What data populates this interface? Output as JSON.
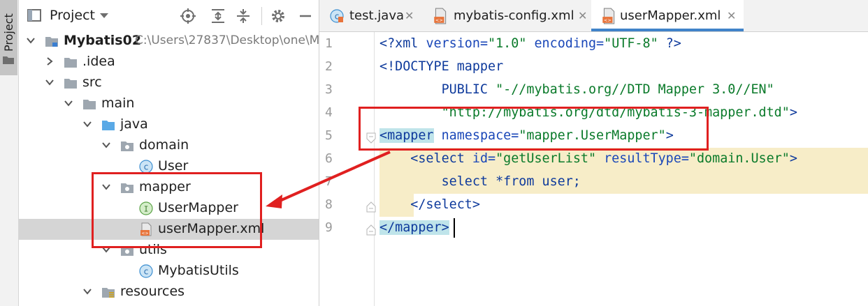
{
  "tool_strip": {
    "project_tab_label": "Project"
  },
  "project_panel": {
    "title": "Project",
    "tree": [
      {
        "label": "Mybatis02",
        "path": "C:\\Users\\27837\\Desktop\\one\\M",
        "icon": "module-folder-icon",
        "expanded": true
      },
      {
        "label": ".idea",
        "icon": "folder-icon",
        "expanded": false
      },
      {
        "label": "src",
        "icon": "folder-icon",
        "expanded": true
      },
      {
        "label": "main",
        "icon": "folder-icon",
        "expanded": true
      },
      {
        "label": "java",
        "icon": "source-folder-icon",
        "expanded": true
      },
      {
        "label": "domain",
        "icon": "package-icon",
        "expanded": true
      },
      {
        "label": "User",
        "icon": "class-icon"
      },
      {
        "label": "mapper",
        "icon": "package-icon",
        "expanded": true
      },
      {
        "label": "UserMapper",
        "icon": "interface-icon"
      },
      {
        "label": "userMapper.xml",
        "icon": "xml-file-icon",
        "selected": true
      },
      {
        "label": "utils",
        "icon": "package-icon",
        "expanded": true
      },
      {
        "label": "MybatisUtils",
        "icon": "class-icon"
      },
      {
        "label": "resources",
        "icon": "resources-folder-icon",
        "expanded": true
      }
    ]
  },
  "editor": {
    "tabs": [
      {
        "label": "test.java",
        "icon": "java-class-icon",
        "active": false
      },
      {
        "label": "mybatis-config.xml",
        "icon": "xml-file-icon",
        "active": false
      },
      {
        "label": "userMapper.xml",
        "icon": "xml-file-icon",
        "active": true
      }
    ],
    "line_numbers": [
      "1",
      "2",
      "3",
      "4",
      "5",
      "6",
      "7",
      "8",
      "9"
    ],
    "code": {
      "l1_a": "<?xml",
      "l1_b": " version=",
      "l1_c": "\"1.0\"",
      "l1_d": " encoding=",
      "l1_e": "\"UTF-8\"",
      "l1_f": " ?>",
      "l2": "<!DOCTYPE mapper",
      "l3_a": "        PUBLIC ",
      "l3_b": "\"-//mybatis.org//DTD Mapper 3.0//EN\"",
      "l4_a": "        ",
      "l4_b": "\"http://mybatis.org/dtd/mybatis-3-mapper.dtd\"",
      "l4_c": ">",
      "l5_a": "<mapper",
      "l5_b": " namespace=",
      "l5_c": "\"mapper.UserMapper\"",
      "l5_d": ">",
      "l6_a": "    <select",
      "l6_b": " id=",
      "l6_c": "\"getUserList\"",
      "l6_d": " resultType=",
      "l6_e": "\"domain.User\"",
      "l6_f": ">",
      "l7": "        select *from user;",
      "l8": "    </select>",
      "l9_a": "</mapper",
      "l9_b": ">"
    }
  },
  "colors": {
    "selection": "#d5d5d5",
    "active_tab_underline": "#4083c9",
    "annotation_red": "#e02020",
    "line_highlight": "#f7edc8",
    "tag_match_highlight": "#bfe4ea"
  }
}
